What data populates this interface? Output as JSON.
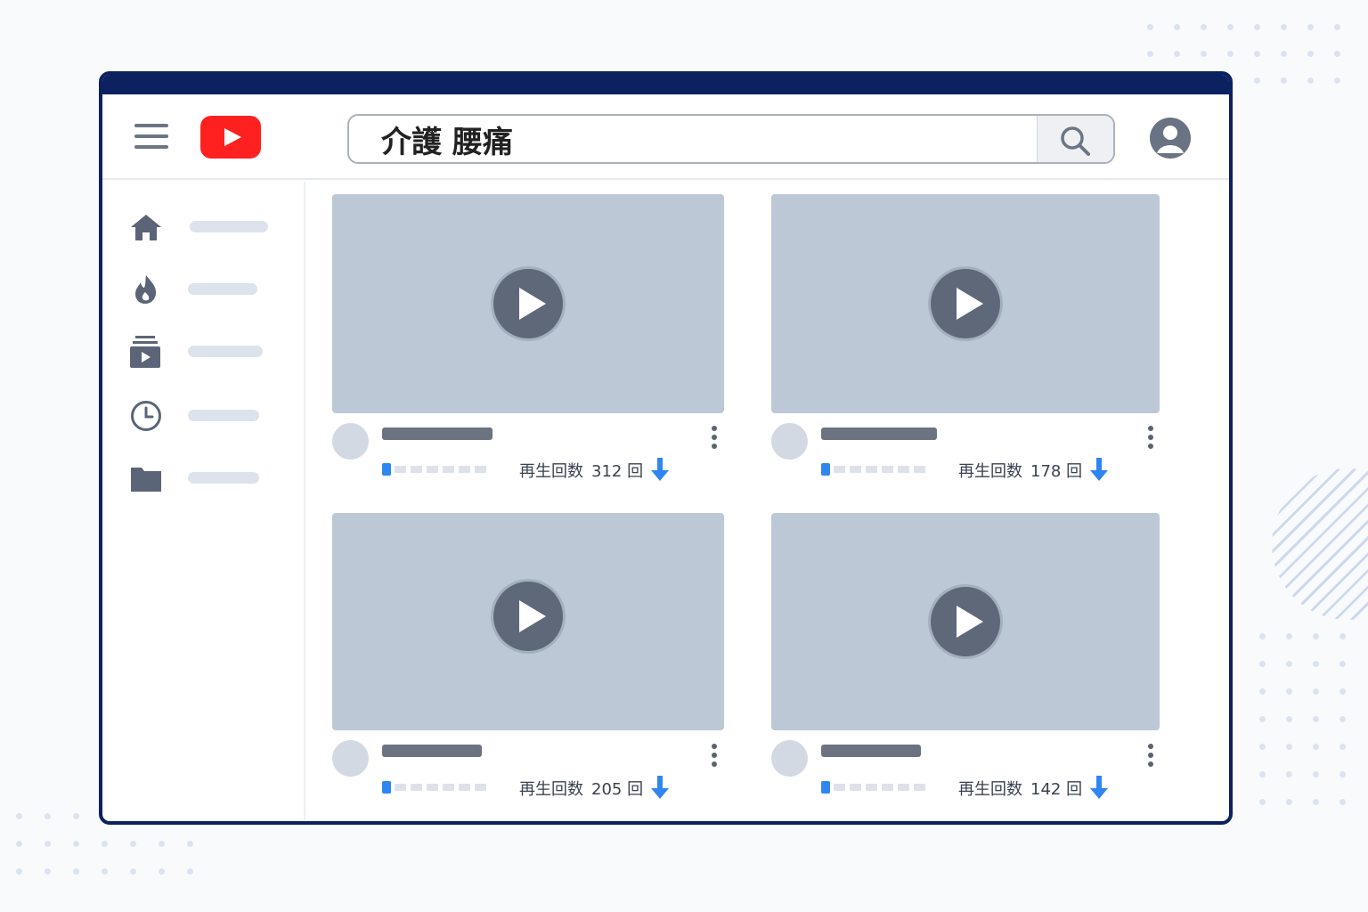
{
  "search": {
    "query": "介護 腰痛"
  },
  "brand": {
    "accent": "#ff2020",
    "frame": "#0b2160",
    "progress": "#2f86f0"
  },
  "sidebar": {
    "items": [
      {
        "icon": "home-icon"
      },
      {
        "icon": "trending-icon"
      },
      {
        "icon": "subscriptions-icon"
      },
      {
        "icon": "history-icon"
      },
      {
        "icon": "library-icon"
      }
    ]
  },
  "videos": [
    {
      "views_label": "再生回数",
      "views": "312",
      "unit": "回"
    },
    {
      "views_label": "再生回数",
      "views": "178",
      "unit": "回"
    },
    {
      "views_label": "再生回数",
      "views": "205",
      "unit": "回"
    },
    {
      "views_label": "再生回数",
      "views": "142",
      "unit": "回"
    }
  ]
}
